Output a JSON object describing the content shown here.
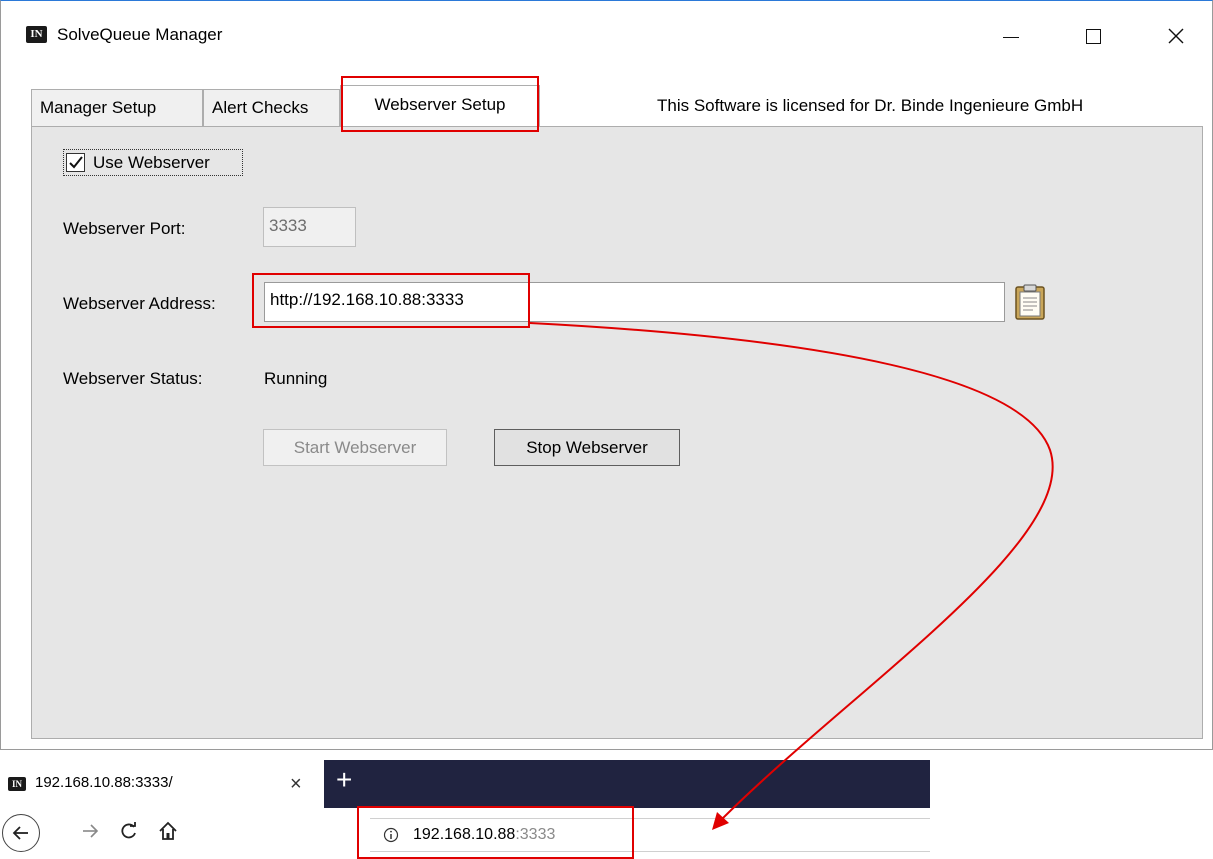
{
  "window": {
    "title": "SolveQueue Manager",
    "logo_text": "IN"
  },
  "tabs": [
    {
      "label": "Manager Setup"
    },
    {
      "label": "Alert Checks"
    },
    {
      "label": "Webserver Setup",
      "selected": true
    }
  ],
  "license_text": "This Software is licensed for Dr. Binde Ingenieure GmbH",
  "webserver": {
    "use_webserver_label": "Use Webserver",
    "use_webserver_checked": true,
    "port_label": "Webserver Port:",
    "port_value": "3333",
    "address_label": "Webserver Address:",
    "address_value": "http://192.168.10.88:3333",
    "status_label": "Webserver Status:",
    "status_value": "Running",
    "start_button": "Start Webserver",
    "stop_button": "Stop Webserver"
  },
  "browser": {
    "tab_title": "192.168.10.88:3333/",
    "tab_close": "×",
    "new_tab": "+",
    "url_host": "192.168.10.88",
    "url_port": ":3333"
  },
  "colors": {
    "annotation": "#e00000",
    "panel_bg": "#e6e6e6",
    "browser_tabbar": "#202340"
  },
  "icons": [
    "minimize-icon",
    "maximize-icon",
    "close-icon",
    "checkmark-icon",
    "clipboard-icon",
    "back-arrow-icon",
    "forward-arrow-icon",
    "reload-icon",
    "home-icon",
    "info-icon"
  ]
}
